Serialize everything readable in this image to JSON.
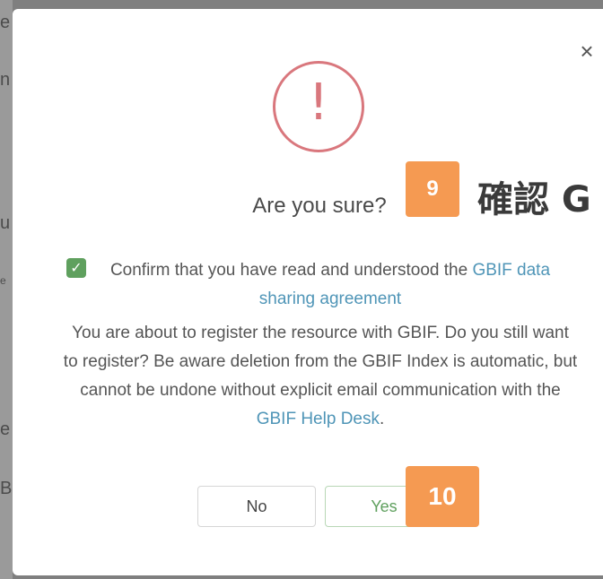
{
  "background": {
    "fragments": [
      "e",
      "n",
      "u",
      "e",
      "e",
      "e",
      "B"
    ]
  },
  "modal": {
    "close_label": "×",
    "warning_icon": "!",
    "title": "Are you sure?",
    "checkbox": {
      "checked": true,
      "check_mark": "✓",
      "text": "Confirm that you have read and understood the ",
      "link_text": "GBIF data sharing agreement"
    },
    "message": {
      "text_before": "You are about to register the resource with GBIF. Do you still want to register? Be aware deletion from the GBIF Index is automatic, but cannot be undone without explicit email communication with the ",
      "link_text": "GBIF Help Desk",
      "text_after": "."
    },
    "buttons": {
      "no_label": "No",
      "yes_label": "Yes"
    }
  },
  "annotations": {
    "badge_9": "9",
    "badge_10": "10",
    "note_9": "確認 G"
  },
  "colors": {
    "accent": "#5fa05e",
    "link": "#4f95b7",
    "warning": "#d9777d",
    "badge": "#f59a52"
  }
}
